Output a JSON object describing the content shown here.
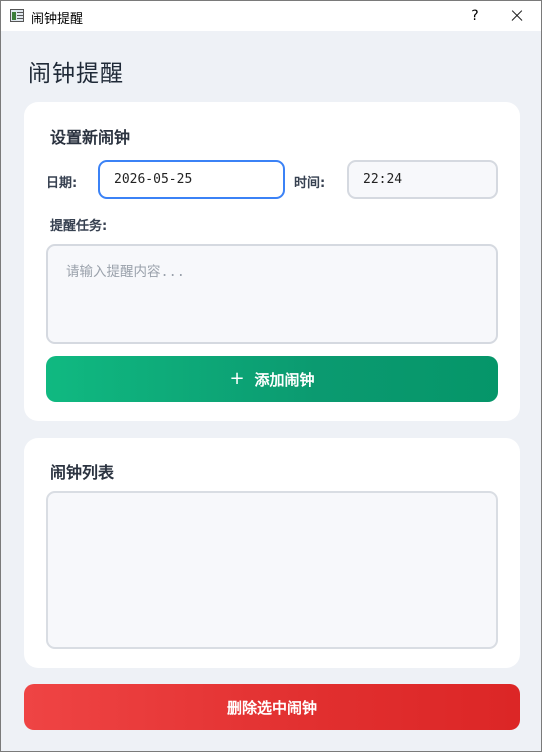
{
  "window": {
    "title": "闹钟提醒",
    "help_label": "?"
  },
  "page": {
    "title": "闹钟提醒"
  },
  "new_alarm": {
    "section_title": "设置新闹钟",
    "date_label": "日期:",
    "date_value": "2026-05-25",
    "time_label": "时间:",
    "time_value": "22:24",
    "task_label": "提醒任务:",
    "task_placeholder": "请输入提醒内容...",
    "add_button_label": "添加闹钟"
  },
  "alarm_list": {
    "section_title": "闹钟列表",
    "items": []
  },
  "delete_button_label": "删除选中闹钟",
  "colors": {
    "accent_green": "#10b981",
    "accent_red": "#ef4444",
    "focus_blue": "#3b82f6",
    "background": "#eef1f6"
  },
  "icons": {
    "app": "alarm-app-icon",
    "add": "plus-icon",
    "close": "close-icon",
    "help": "help-icon"
  }
}
